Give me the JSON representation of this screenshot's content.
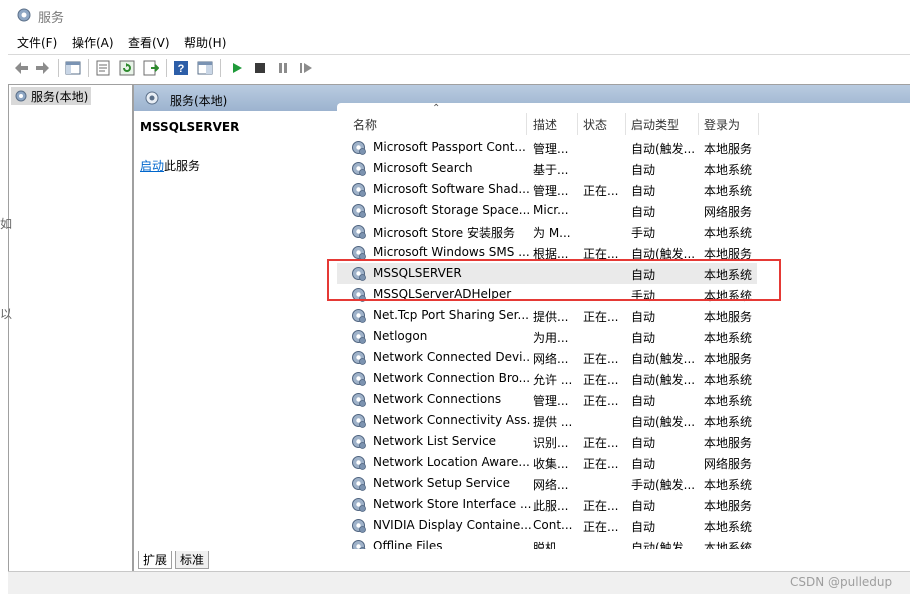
{
  "window": {
    "title": "服务"
  },
  "menu": [
    "文件(F)",
    "操作(A)",
    "查看(V)",
    "帮助(H)"
  ],
  "toolbar": [
    "back-icon",
    "forward-icon",
    "show-tree-icon",
    "properties-icon",
    "refresh-icon",
    "export-icon",
    "help-icon",
    "console-icon",
    "play-icon",
    "stop-icon",
    "pause-icon",
    "restart-icon"
  ],
  "tree": {
    "item": "服务(本地)"
  },
  "header": {
    "title": "服务(本地)"
  },
  "detail": {
    "service_name": "MSSQLSERVER",
    "start_link": "启动",
    "start_suffix": "此服务"
  },
  "columns": [
    "名称",
    "描述",
    "状态",
    "启动类型",
    "登录为"
  ],
  "rows": [
    [
      "Microsoft Passport Cont...",
      "管理...",
      "",
      "自动(触发...",
      "本地服务"
    ],
    [
      "Microsoft Search",
      "基于...",
      "",
      "自动",
      "本地系统"
    ],
    [
      "Microsoft Software Shad...",
      "管理...",
      "正在...",
      "自动",
      "本地系统"
    ],
    [
      "Microsoft Storage Space...",
      "Micr...",
      "",
      "自动",
      "网络服务"
    ],
    [
      "Microsoft Store 安装服务",
      "为 M...",
      "",
      "手动",
      "本地系统"
    ],
    [
      "Microsoft Windows SMS ...",
      "根据...",
      "正在...",
      "自动(触发...",
      "本地服务"
    ],
    [
      "MSSQLSERVER",
      "",
      "",
      "自动",
      "本地系统"
    ],
    [
      "MSSQLServerADHelper",
      "",
      "",
      "手动",
      "本地系统"
    ],
    [
      "Net.Tcp Port Sharing Ser...",
      "提供...",
      "正在...",
      "自动",
      "本地服务"
    ],
    [
      "Netlogon",
      "为用...",
      "",
      "自动",
      "本地系统"
    ],
    [
      "Network Connected Devi...",
      "网络...",
      "正在...",
      "自动(触发...",
      "本地服务"
    ],
    [
      "Network Connection Bro...",
      "允许 ...",
      "正在...",
      "自动(触发...",
      "本地系统"
    ],
    [
      "Network Connections",
      "管理...",
      "正在...",
      "自动",
      "本地系统"
    ],
    [
      "Network Connectivity Ass...",
      "提供 ...",
      "",
      "自动(触发...",
      "本地系统"
    ],
    [
      "Network List Service",
      "识别...",
      "正在...",
      "自动",
      "本地服务"
    ],
    [
      "Network Location Aware...",
      "收集...",
      "正在...",
      "自动",
      "网络服务"
    ],
    [
      "Network Setup Service",
      "网络...",
      "",
      "手动(触发...",
      "本地系统"
    ],
    [
      "Network Store Interface ...",
      "此服...",
      "正在...",
      "自动",
      "本地服务"
    ],
    [
      "NVIDIA Display Containe...",
      "Cont...",
      "正在...",
      "自动",
      "本地系统"
    ],
    [
      "Offline Files",
      "脱机...",
      "",
      "自动(触发...",
      "本地系统"
    ]
  ],
  "tabs": [
    "扩展",
    "标准"
  ],
  "watermark": "CSDN @pulledup",
  "fragments": [
    "如",
    "以"
  ],
  "colors": {
    "header_bar": "#b9cbe0",
    "highlight": "#e53935",
    "link": "#0066cc"
  }
}
